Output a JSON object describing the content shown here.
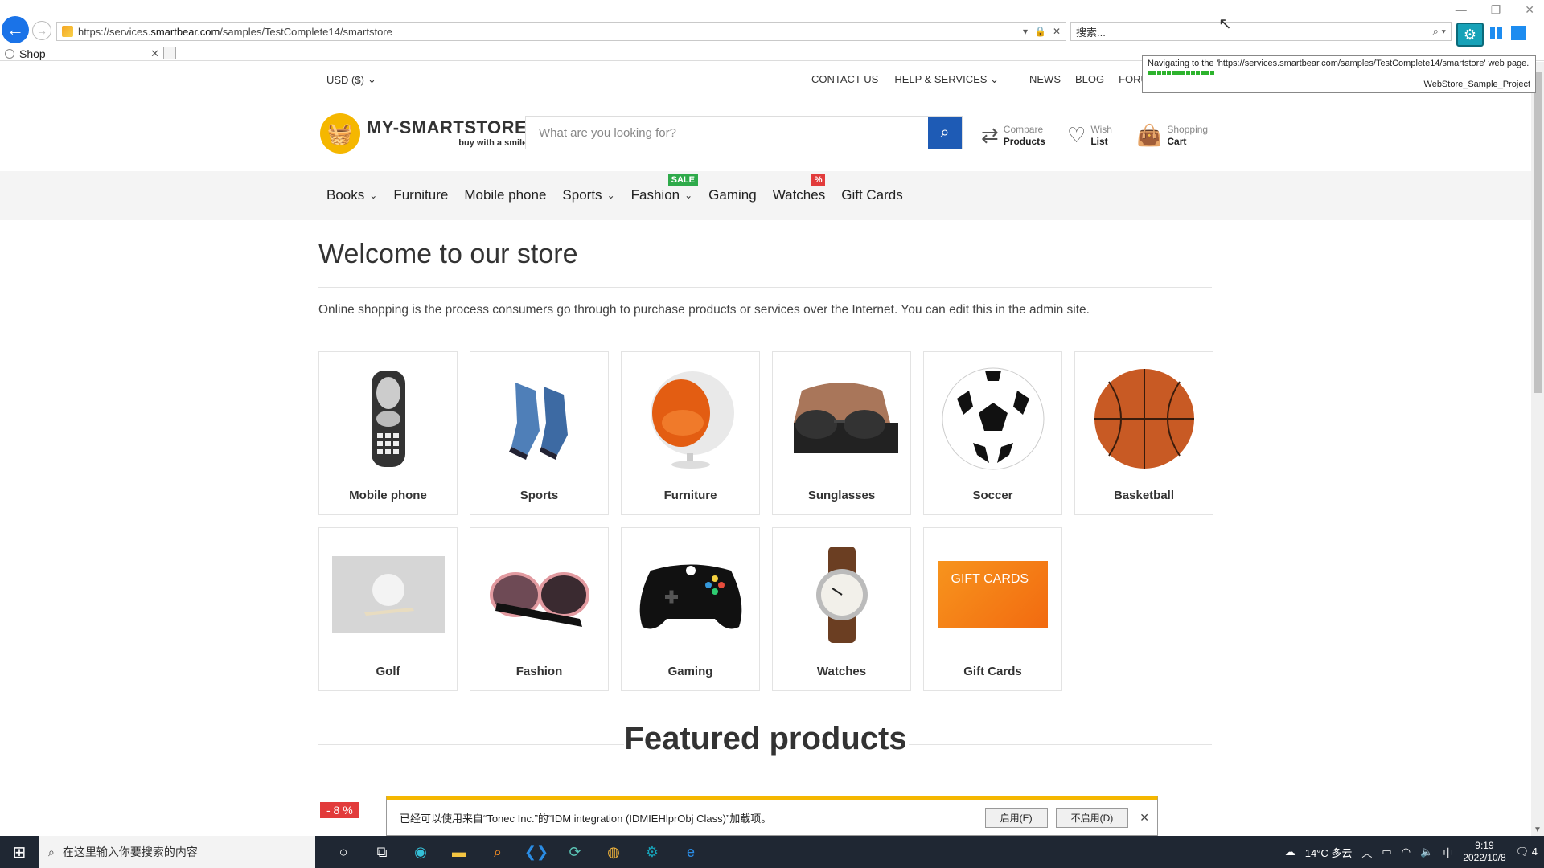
{
  "browser": {
    "url_prefix": "https://services.",
    "url_domain": "smartbear.com",
    "url_path": "/samples/TestComplete14/smartstore",
    "search_placeholder": "搜索...",
    "tab_title": "Shop"
  },
  "tooltip": {
    "message": "Navigating to the 'https://services.smartbear.com/samples/TestComplete14/smartstore' web page.",
    "project": "WebStore_Sample_Project"
  },
  "topbar": {
    "currency": "USD  ($)",
    "links": [
      "CONTACT US",
      "HELP & SERVICES",
      "NEWS",
      "BLOG",
      "FORUMS"
    ]
  },
  "header": {
    "logo_name": "MY-SMARTSTORE",
    "logo_tagline": "buy with a smile",
    "search_placeholder": "What are you looking for?",
    "compare_top": "Compare",
    "compare_bottom": "Products",
    "wish_top": "Wish",
    "wish_bottom": "List",
    "cart_top": "Shopping",
    "cart_bottom": "Cart"
  },
  "nav": {
    "items": [
      "Books",
      "Furniture",
      "Mobile phone",
      "Sports",
      "Fashion",
      "Gaming",
      "Watches",
      "Gift Cards"
    ],
    "sale_badge": "SALE",
    "pct_badge": "%"
  },
  "welcome": {
    "title": "Welcome to our store",
    "text": "Online shopping is the process consumers go through to purchase products or services over the Internet. You can edit this in the admin site."
  },
  "categories_row1": [
    "Mobile phone",
    "Sports",
    "Furniture",
    "Sunglasses",
    "Soccer",
    "Basketball"
  ],
  "categories_row2": [
    "Golf",
    "Fashion",
    "Gaming",
    "Watches",
    "Gift Cards"
  ],
  "gift_card_text": "GIFT CARDS",
  "featured": {
    "title": "Featured products",
    "discount": "- 8 %"
  },
  "notification": {
    "message": "已经可以使用来自“Tonec Inc.”的“IDM integration (IDMIEHlprObj Class)”加载项。",
    "enable": "启用(E)",
    "disable": "不启用(D)"
  },
  "taskbar": {
    "search_placeholder": "在这里输入你要搜索的内容",
    "weather": "14°C  多云",
    "ime": "中",
    "time": "9:19",
    "date": "2022/10/8",
    "notif_count": "4"
  }
}
